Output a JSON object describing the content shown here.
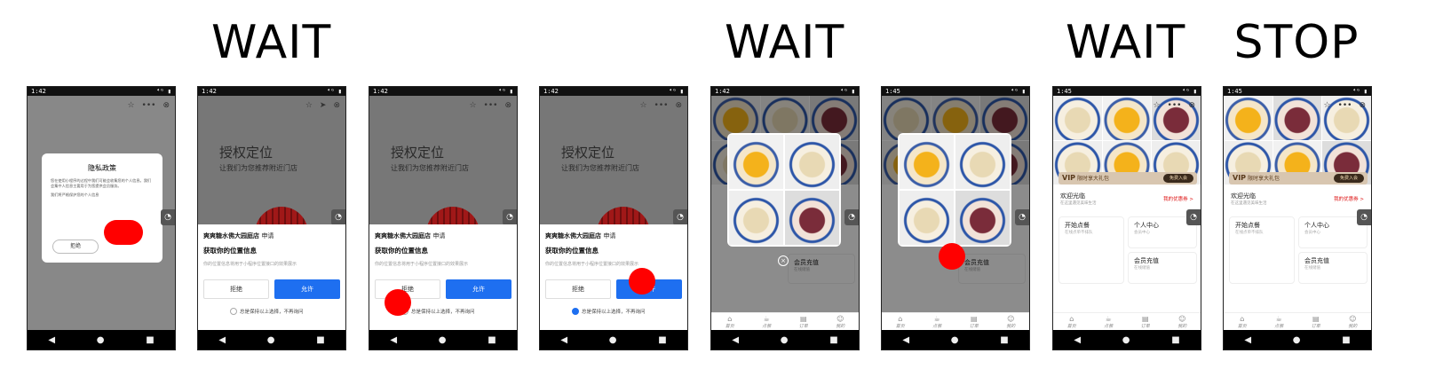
{
  "labels": [
    "WAIT",
    "WAIT",
    "WAIT",
    "STOP"
  ],
  "status": {
    "time1": "1:42",
    "time2": "1:45",
    "right": "⁴ᴳ ▮"
  },
  "capsule": {
    "star": "☆",
    "more": "•••",
    "close": "⊗"
  },
  "nav": {
    "back": "◀",
    "home": "●",
    "recents": "■"
  },
  "privacy": {
    "title": "隐私政策",
    "body1": "您在使用小程序的过程中我们可能会收集您的个人信息。我们会集中人信息主要用于为您提供会员服务。",
    "body2": "我们将严格保护您的个人信息",
    "reject": "拒绝"
  },
  "location": {
    "title": "授权定位",
    "subtitle": "让我们为您推荐附近门店",
    "shop": "爽爽糖水佛大园庭店",
    "apply": "申请",
    "ask": "获取你的位置信息",
    "desc": "你的位置信息将用于小程序位置接口的效果展示",
    "reject": "拒绝",
    "allow": "允许",
    "checkbox": "总是保持以上选择，不再询问"
  },
  "home": {
    "vip": "VIP",
    "vip_text": "限时享大礼包",
    "join": "免费入会",
    "welcome": "欢迎光临",
    "welcome_sub": "在这里遇见美味生活",
    "coupon": "我的优惠券 >",
    "order": "开始点餐",
    "order_sub": "在线点单不排队",
    "member": "个人中心",
    "member_sub": "会员中心",
    "recharge": "会员充值",
    "recharge_sub": "在线储值",
    "tabs": [
      "首页",
      "点餐",
      "订单",
      "我的"
    ]
  },
  "close_glyph": "×"
}
